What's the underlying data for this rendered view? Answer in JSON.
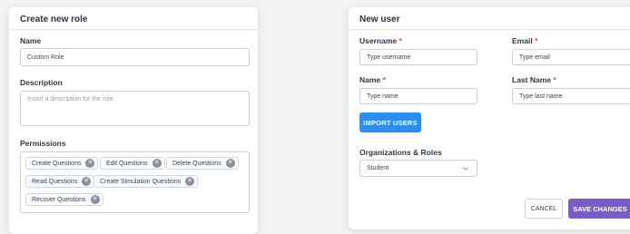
{
  "role_form": {
    "title": "Create new role",
    "name_label": "Name",
    "name_value": "Custom Role",
    "description_label": "Description",
    "description_placeholder": "Insert a description for the role",
    "permissions_label": "Permissions",
    "permissions": [
      "Create Questions",
      "Edit Questions",
      "Delete Questions",
      "Read Questions",
      "Create Simulation Questions",
      "Recover Questions"
    ]
  },
  "user_form": {
    "title": "New user",
    "username_label": "Username",
    "username_placeholder": "Type username",
    "email_label": "Email",
    "email_placeholder": "Type email",
    "name_label": "Name",
    "name_placeholder": "Type name",
    "last_name_label": "Last Name",
    "last_name_placeholder": "Type last name",
    "required_mark": "*",
    "import_button": "IMPORT USERS",
    "org_roles_label": "Organizations & Roles",
    "org_role_selected": "Student",
    "cancel_button": "CANCEL",
    "save_button": "SAVE CHANGES"
  },
  "colors": {
    "primary_blue": "#2d8ef0",
    "save_purple": "#7a5cc9",
    "required_red": "#e0483d"
  }
}
